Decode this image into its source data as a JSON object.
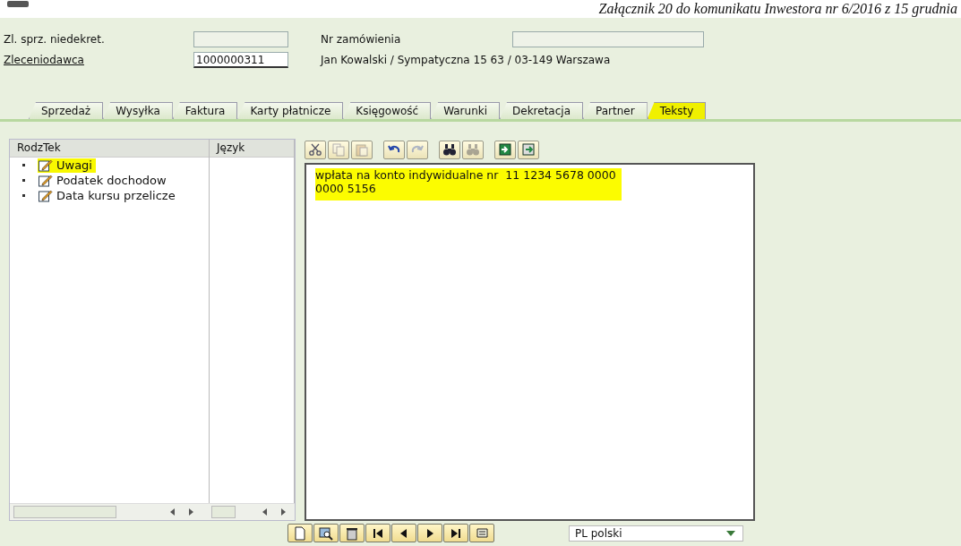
{
  "document_header": "Załącznik 20 do komunikatu Inwestora nr 6/2016 z 15 grudnia",
  "header_fields": [
    {
      "label": "Zl. sprz. niedekret.",
      "link": false
    },
    {
      "label": "Zleceniodawca",
      "link": true,
      "value": "1000000311"
    }
  ],
  "order_field": {
    "label": "Nr zamówienia"
  },
  "customer_text": "Jan Kowalski / Sympatyczna 15 63 / 03-149 Warszawa",
  "tabs": [
    {
      "label": "Sprzedaż",
      "selected": false
    },
    {
      "label": "Wysyłka",
      "selected": false
    },
    {
      "label": "Faktura",
      "selected": false
    },
    {
      "label": "Karty płatnicze",
      "selected": false
    },
    {
      "label": "Księgowość",
      "selected": false
    },
    {
      "label": "Warunki",
      "selected": false
    },
    {
      "label": "Dekretacja",
      "selected": false
    },
    {
      "label": "Partner",
      "selected": false
    },
    {
      "label": "Teksty",
      "selected": true
    }
  ],
  "text_tree": {
    "columns": [
      "RodzTek",
      "Język"
    ],
    "items": [
      {
        "label": "Uwagi",
        "selected": true
      },
      {
        "label": "Podatek dochodow",
        "selected": false
      },
      {
        "label": "Data kursu przelicze",
        "selected": false
      }
    ]
  },
  "editor_toolbar": [
    {
      "kind": "cut",
      "disabled": false
    },
    {
      "kind": "copy",
      "disabled": true
    },
    {
      "kind": "paste",
      "disabled": true
    },
    {
      "kind": "undo",
      "disabled": false
    },
    {
      "kind": "redo",
      "disabled": true
    },
    {
      "kind": "find",
      "disabled": false
    },
    {
      "kind": "find-next",
      "disabled": true
    },
    {
      "kind": "import",
      "disabled": false
    },
    {
      "kind": "export",
      "disabled": false
    }
  ],
  "editor": {
    "lines": [
      "wpłata na konto indywidualne nr  11 1234 5678 0000",
      "0000 5156"
    ],
    "highlighted": true
  },
  "bottom_toolbar": [
    {
      "kind": "new"
    },
    {
      "kind": "preview"
    },
    {
      "kind": "delete"
    },
    {
      "kind": "first"
    },
    {
      "kind": "prev"
    },
    {
      "kind": "next"
    },
    {
      "kind": "last"
    },
    {
      "kind": "scroll"
    }
  ],
  "language_select": {
    "value": "PL polski"
  }
}
